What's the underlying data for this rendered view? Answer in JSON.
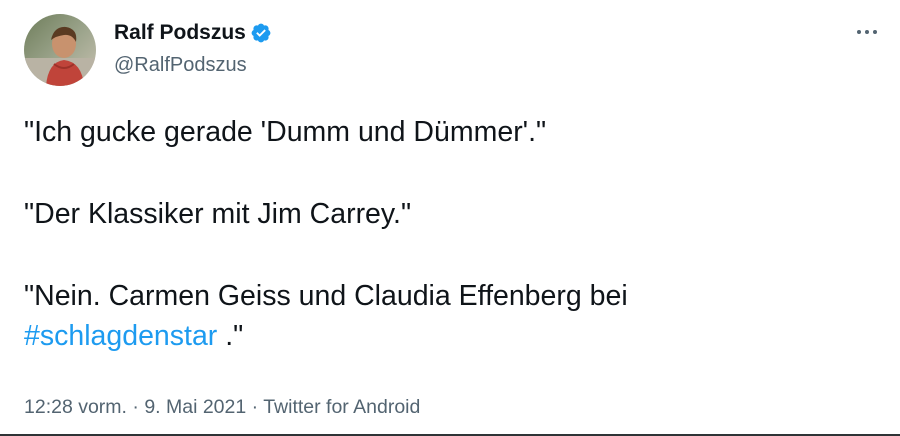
{
  "author": {
    "display_name": "Ralf Podszus",
    "handle": "@RalfPodszus",
    "verified": true
  },
  "tweet": {
    "line1": "\"Ich gucke gerade 'Dumm und Dümmer'.\"",
    "line2": "\"Der Klassiker mit Jim Carrey.\"",
    "line3_text": "\"Nein. Carmen Geiss und Claudia Effenberg bei",
    "hashtag": "#schlagdenstar",
    "line3_tail": " .\""
  },
  "meta": {
    "time": "12:28 vorm.",
    "separator1": " · ",
    "date": "9. Mai 2021",
    "separator2": " · ",
    "source": "Twitter for Android"
  },
  "colors": {
    "accent": "#1d9bf0",
    "text": "#0f1419",
    "secondary": "#536471"
  },
  "icons": {
    "verified": "verified-badge-icon",
    "more": "more-options-icon"
  }
}
